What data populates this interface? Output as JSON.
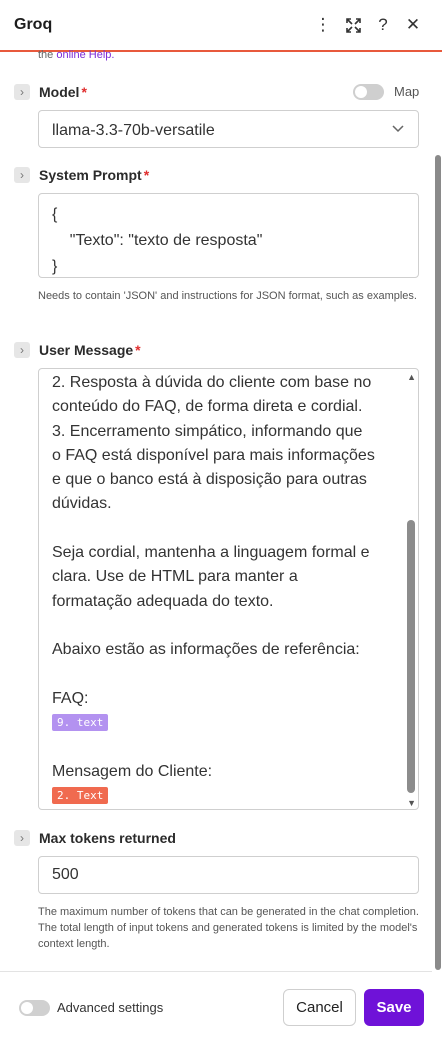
{
  "header": {
    "title": "Groq",
    "icons": [
      "more-vert-icon",
      "expand-icon",
      "help-icon",
      "close-icon"
    ],
    "accent_color": "#e8593c"
  },
  "help_line": {
    "prefix": "the",
    "link": "online Help."
  },
  "model": {
    "label": "Model",
    "required": "*",
    "map_label": "Map",
    "value": "llama-3.3-70b-versatile"
  },
  "system_prompt": {
    "label": "System Prompt",
    "required": "*",
    "text": "{\n    \"Texto\": \"texto de resposta\"\n}",
    "hint": "Needs to contain 'JSON' and instructions for JSON format, such as examples."
  },
  "user_message": {
    "label": "User Message",
    "required": "*",
    "lines": [
      "2. Resposta à dúvida do cliente com base no",
      "conteúdo do FAQ, de forma direta e cordial.",
      "3. Encerramento simpático, informando que",
      "o FAQ está disponível para mais informações",
      "e que o banco está à disposição para outras",
      "dúvidas.",
      "",
      "Seja cordial, mantenha a linguagem formal e",
      "clara. Use de HTML para manter a",
      "formatação adequada do texto.",
      "",
      "Abaixo estão as informações de referência:",
      "",
      "FAQ:"
    ],
    "tag_faq": "9. text",
    "blank_after_faq": "",
    "client_label": "Mensagem do Cliente:",
    "tag_client": "2. Text"
  },
  "max_tokens": {
    "label": "Max tokens returned",
    "value": "500",
    "hint": "The maximum number of tokens that can be generated in the chat completion. The total length of input tokens and generated tokens is limited by the model's context length."
  },
  "footer": {
    "advanced_label": "Advanced settings",
    "cancel_label": "Cancel",
    "save_label": "Save",
    "save_color": "#6f12d8"
  }
}
